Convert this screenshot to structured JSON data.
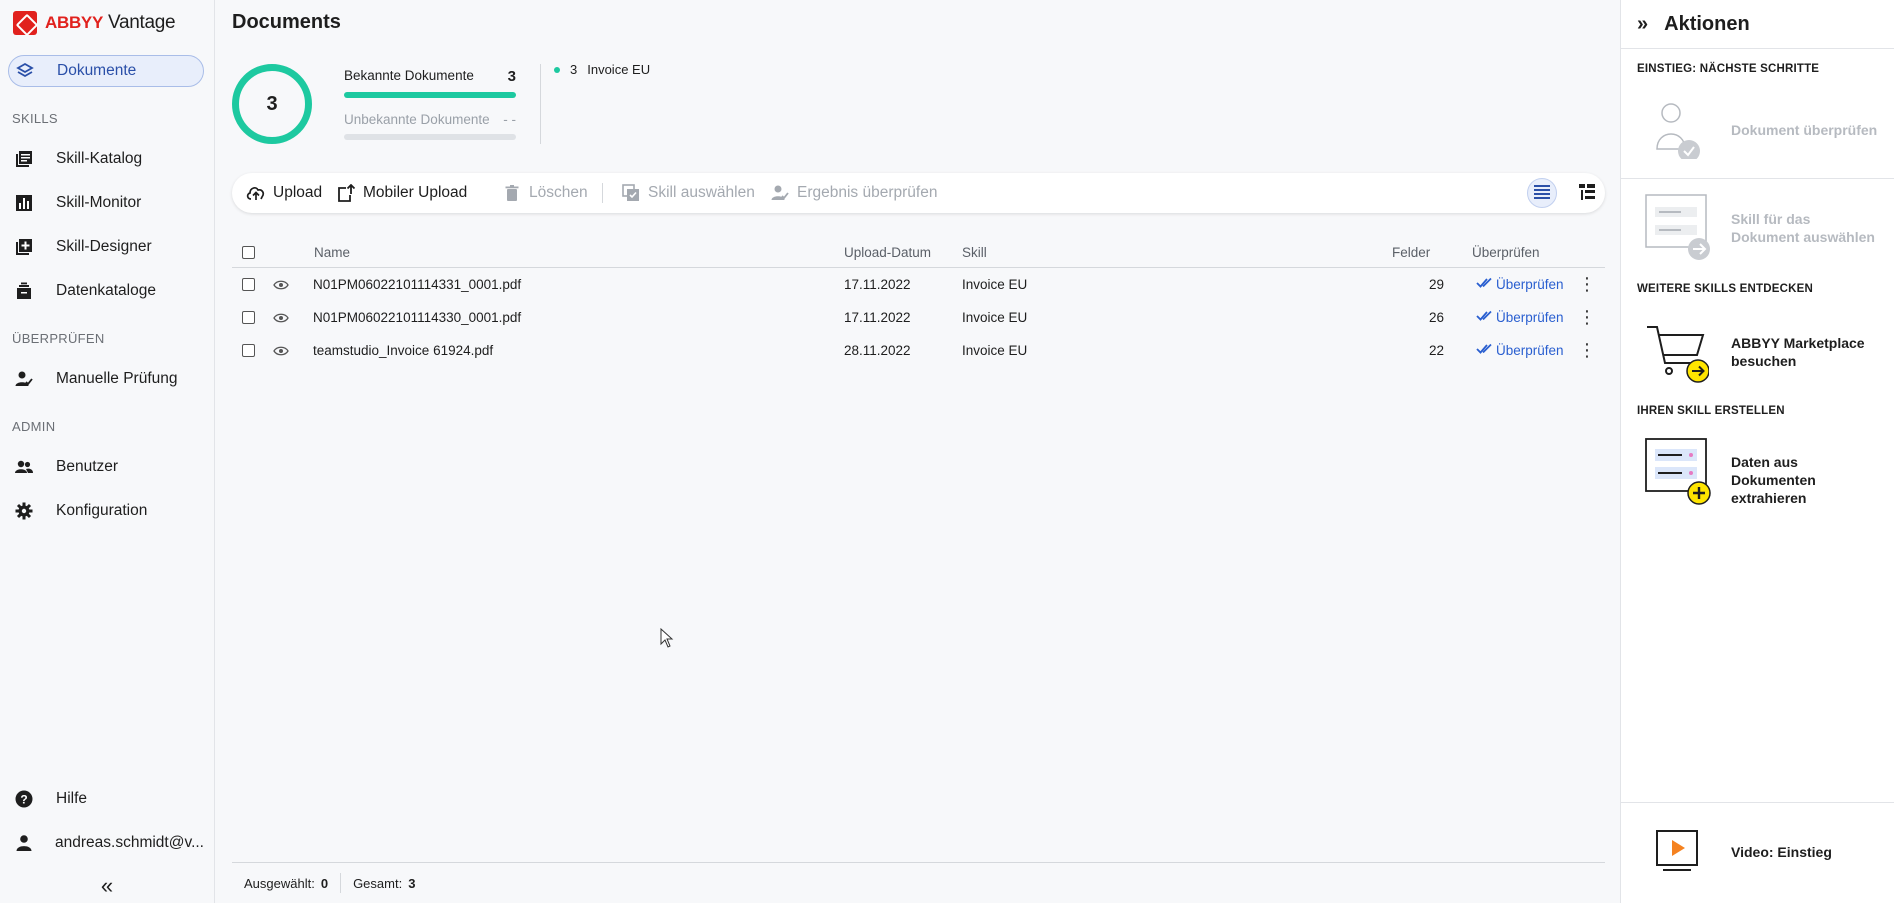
{
  "app": {
    "brand_abbyy": "ABBYY",
    "brand_product": "Vantage"
  },
  "sidebar": {
    "active": "Dokumente",
    "documents": "Dokumente",
    "sections": {
      "skills": "SKILLS",
      "review": "ÜBERPRÜFEN",
      "admin": "ADMIN"
    },
    "items": {
      "skill_catalog": "Skill-Katalog",
      "skill_monitor": "Skill-Monitor",
      "skill_designer": "Skill-Designer",
      "data_catalogs": "Datenkataloge",
      "manual_review": "Manuelle Prüfung",
      "users": "Benutzer",
      "configuration": "Konfiguration",
      "help": "Hilfe",
      "account": "andreas.schmidt@v..."
    }
  },
  "main": {
    "title": "Documents",
    "summary": {
      "total": "3",
      "known_label": "Bekannte Dokumente",
      "known_count": "3",
      "unknown_label": "Unbekannte Dokumente",
      "unknown_count": "- -",
      "legend": [
        {
          "count": "3",
          "label": "Invoice EU",
          "color": "#1dc9a0"
        }
      ]
    },
    "toolbar": {
      "upload": "Upload",
      "mobile_upload": "Mobiler Upload",
      "delete": "Löschen",
      "select_skill": "Skill auswählen",
      "review_result": "Ergebnis überprüfen"
    },
    "table": {
      "columns": {
        "name": "Name",
        "upload_date": "Upload-Datum",
        "skill": "Skill",
        "fields": "Felder",
        "review": "Überprüfen"
      },
      "rows": [
        {
          "name": "N01PM06022101114331_0001.pdf",
          "date": "17.11.2022",
          "skill": "Invoice EU",
          "fields": "29",
          "action": "Überprüfen"
        },
        {
          "name": "N01PM06022101114330_0001.pdf",
          "date": "17.11.2022",
          "skill": "Invoice EU",
          "fields": "26",
          "action": "Überprüfen"
        },
        {
          "name": "teamstudio_Invoice 61924.pdf",
          "date": "28.11.2022",
          "skill": "Invoice EU",
          "fields": "22",
          "action": "Überprüfen"
        }
      ]
    },
    "footer": {
      "selected_label": "Ausgewählt:",
      "selected_value": "0",
      "total_label": "Gesamt:",
      "total_value": "3"
    }
  },
  "panel": {
    "title": "Aktionen",
    "section_next": "EINSTIEG: NÄCHSTE SCHRITTE",
    "review_doc": "Dokument überprüfen",
    "select_skill_doc": "Skill für das Dokument auswählen",
    "section_more": "WEITERE SKILLS ENTDECKEN",
    "marketplace": "ABBYY Marketplace besuchen",
    "section_create": "IHREN SKILL ERSTELLEN",
    "extract": "Daten aus Dokumenten extrahieren",
    "video": "Video: Einstieg"
  },
  "colors": {
    "accent": "#2a5fd0",
    "teal": "#1dc9a0",
    "brand_red": "#e1211d",
    "yellow": "#ffe500"
  }
}
